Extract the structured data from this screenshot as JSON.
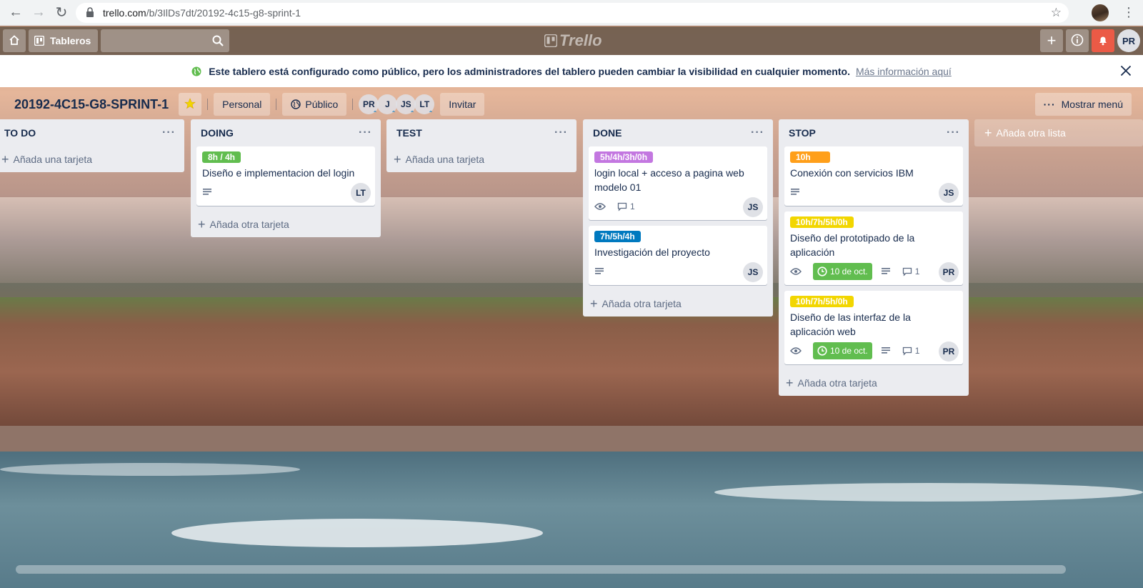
{
  "browser": {
    "url_host": "trello.com",
    "url_path": "/b/3IlDs7dt/20192-4c15-g8-sprint-1"
  },
  "topbar": {
    "boards_label": "Tableros",
    "logo_text": "Trello",
    "avatar_initials": "PR"
  },
  "banner": {
    "message": "Este tablero está configurado como público, pero los administradores del tablero pueden cambiar la visibilidad en cualquier momento.",
    "link": "Más información aquí"
  },
  "board": {
    "title": "20192-4C15-G8-SPRINT-1",
    "team_label": "Personal",
    "visibility_label": "Público",
    "members": [
      "PR",
      "J",
      "JS",
      "LT"
    ],
    "invite_label": "Invitar",
    "show_menu_label": "Mostrar menú"
  },
  "lists": [
    {
      "title": "TO DO",
      "add_label": "Añada una tarjeta",
      "cards": []
    },
    {
      "title": "DOING",
      "add_label": "Añada otra tarjeta",
      "cards": [
        {
          "label": "8h / 4h",
          "label_color": "#61bd4f",
          "title": "Diseño e implementacion del login",
          "member": "LT"
        }
      ]
    },
    {
      "title": "TEST",
      "add_label": "Añada una tarjeta",
      "cards": []
    },
    {
      "title": "DONE",
      "add_label": "Añada otra tarjeta",
      "cards": [
        {
          "label": "5h/4h/3h/0h",
          "label_color": "#c377e0",
          "title": "login local + acceso a pagina web modelo 01",
          "comments": "1",
          "member": "JS"
        },
        {
          "label": "7h/5h/4h",
          "label_color": "#0079bf",
          "title": "Investigación del proyecto",
          "member": "JS"
        }
      ]
    },
    {
      "title": "STOP",
      "add_label": "Añada otra tarjeta",
      "cards": [
        {
          "label": "10h",
          "label_color": "#ff9f1a",
          "title": "Conexión con servicios IBM",
          "member": "JS"
        },
        {
          "label": "10h/7h/5h/0h",
          "label_color": "#f2d600",
          "title": "Diseño del prototipado de la aplicación",
          "due": "10 de oct.",
          "comments": "1",
          "member": "PR"
        },
        {
          "label": "10h/7h/5h/0h",
          "label_color": "#f2d600",
          "title": "Diseño de las interfaz de la aplicación web",
          "due": "10 de oct.",
          "comments": "1",
          "member": "PR"
        }
      ]
    }
  ],
  "add_list_label": "Añada otra lista"
}
